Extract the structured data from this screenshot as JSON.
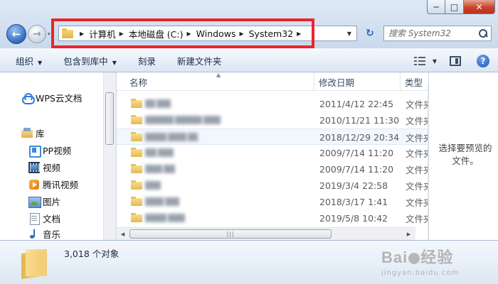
{
  "window": {
    "min_glyph": "─",
    "max_glyph": "□",
    "close_glyph": "✕"
  },
  "nav": {
    "back_glyph": "←",
    "forward_glyph": "→",
    "recent_glyph": "▾"
  },
  "address": {
    "crumbs": [
      "计算机",
      "本地磁盘 (C:)",
      "Windows",
      "System32"
    ],
    "separator_glyph": "▶",
    "dropdown_glyph": "▼",
    "refresh_glyph": "↻",
    "highlight_color": "#e8262c"
  },
  "search": {
    "placeholder": "搜索 System32"
  },
  "toolbar": {
    "organize": "组织",
    "include_in_library": "包含到库中",
    "burn": "刻录",
    "new_folder": "新建文件夹",
    "caret_glyph": "▼",
    "help_glyph": "?"
  },
  "sidebar": {
    "items": [
      {
        "label": "WPS云文档",
        "icon": "cloud-icon"
      },
      {
        "label": "库",
        "icon": "library-icon"
      },
      {
        "label": "PP视频",
        "icon": "pp-video-icon"
      },
      {
        "label": "视频",
        "icon": "video-icon"
      },
      {
        "label": "腾讯视频",
        "icon": "tencent-video-icon"
      },
      {
        "label": "图片",
        "icon": "picture-icon"
      },
      {
        "label": "文档",
        "icon": "document-icon"
      },
      {
        "label": "音乐",
        "icon": "music-icon"
      }
    ]
  },
  "filelist": {
    "columns": {
      "name": "名称",
      "date": "修改日期",
      "type": "类型"
    },
    "sort_glyph": "▲",
    "rows": [
      {
        "date": "2011/4/12 22:45",
        "type": "文件夹"
      },
      {
        "date": "2010/11/21 11:30",
        "type": "文件夹"
      },
      {
        "date": "2018/12/29 20:34",
        "type": "文件夹"
      },
      {
        "date": "2009/7/14 11:20",
        "type": "文件夹"
      },
      {
        "date": "2009/7/14 11:20",
        "type": "文件夹"
      },
      {
        "date": "2019/3/4 22:58",
        "type": "文件夹"
      },
      {
        "date": "2018/3/17 1:41",
        "type": "文件夹"
      },
      {
        "date": "2019/5/8 10:42",
        "type": "文件夹"
      }
    ],
    "hscroll_left": "◀",
    "hscroll_right": "▶",
    "grip": "|||"
  },
  "preview": {
    "message": "选择要预览的文件。"
  },
  "details": {
    "count_text": "3,018 个对象"
  },
  "watermark": {
    "main_a": "Bai",
    "main_b": "经验",
    "url": "jingyan.baidu.com"
  }
}
